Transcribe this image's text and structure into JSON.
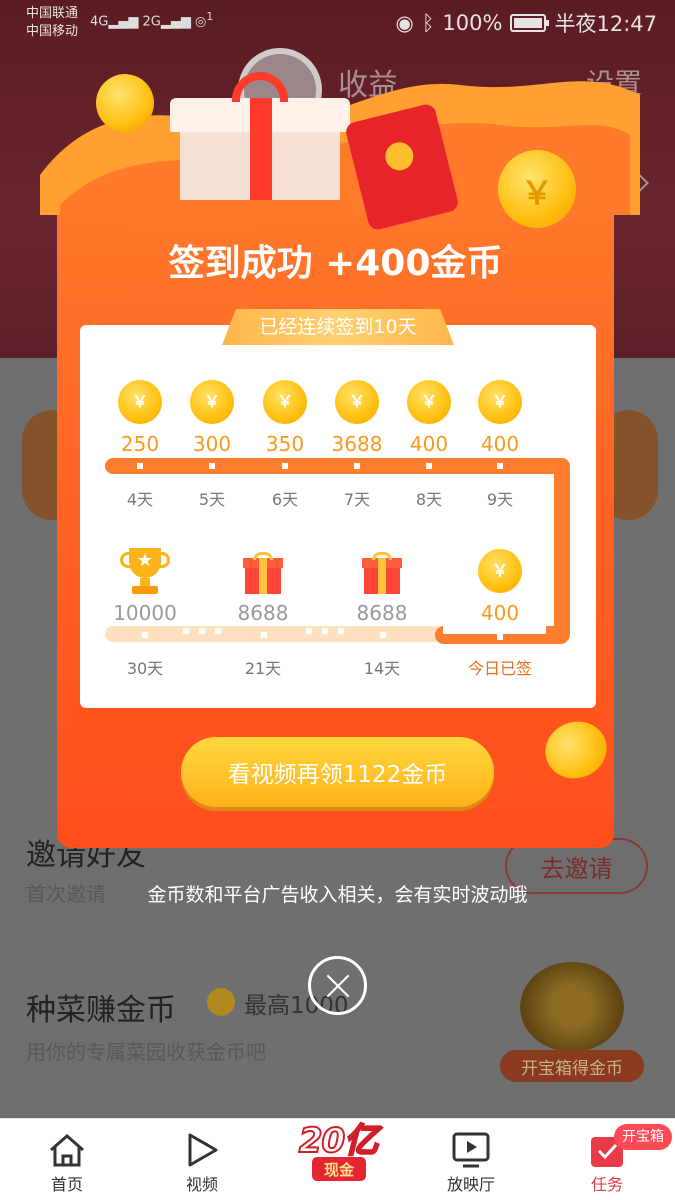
{
  "status_bar": {
    "carrier1": "中国联通",
    "carrier2": "中国移动",
    "signal1": "4G",
    "signal2": "2G",
    "wifi_sup": "1",
    "battery_pct": "100%",
    "time": "半夜12:47"
  },
  "background": {
    "tab_earn": "收益",
    "tab_settings": "设置",
    "invite": {
      "title": "邀请好友",
      "subtitle": "首次邀请",
      "button": "去邀请"
    },
    "veg": {
      "title": "种菜赚金币",
      "max": "最高1000",
      "subtitle": "用你的专属菜园收获金币吧"
    },
    "chest_label": "开宝箱得金币"
  },
  "popup": {
    "title": "签到成功 +400金币",
    "streak": "已经连续签到10天",
    "coin_symbol": "￥",
    "row1": [
      {
        "amount": "250",
        "day": "4天"
      },
      {
        "amount": "300",
        "day": "5天"
      },
      {
        "amount": "350",
        "day": "6天"
      },
      {
        "amount": "3688",
        "day": "7天"
      },
      {
        "amount": "400",
        "day": "8天"
      },
      {
        "amount": "400",
        "day": "9天"
      }
    ],
    "row2": [
      {
        "amount": "10000",
        "day": "30天"
      },
      {
        "amount": "8688",
        "day": "21天"
      },
      {
        "amount": "8688",
        "day": "14天"
      },
      {
        "amount": "400",
        "day": "今日已签"
      }
    ],
    "cta": "看视频再领1122金币"
  },
  "disclaimer": "金币数和平台广告收入相关，会有实时波动哦",
  "bottom_nav": {
    "home": "首页",
    "video": "视频",
    "center_big": "20亿",
    "center_small": "现金",
    "cinema": "放映厅",
    "task": "任务",
    "badge": "开宝箱"
  },
  "colors": {
    "popup_orange": "#ff6224",
    "coin_gold": "#ffc010",
    "cta_yellow": "#ffc42a",
    "accent_red": "#e83b4a"
  }
}
